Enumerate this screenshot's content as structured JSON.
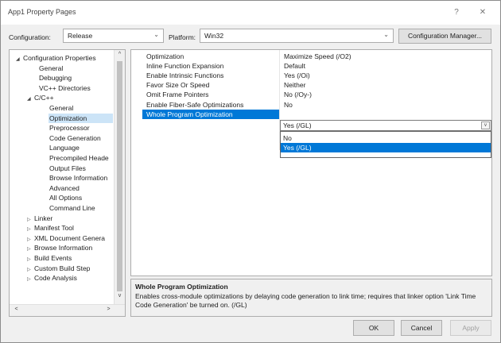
{
  "window": {
    "title": "App1 Property Pages",
    "help": "?",
    "close": "✕"
  },
  "config": {
    "configuration_label": "Configuration:",
    "configuration_value": "Release",
    "platform_label": "Platform:",
    "platform_value": "Win32",
    "manager_button": "Configuration Manager..."
  },
  "tree": {
    "items": [
      {
        "label": "Configuration Properties",
        "twisty": "◢"
      },
      {
        "label": "General"
      },
      {
        "label": "Debugging"
      },
      {
        "label": "VC++ Directories"
      },
      {
        "label": "C/C++",
        "twisty": "◢"
      },
      {
        "label": "General"
      },
      {
        "label": "Optimization"
      },
      {
        "label": "Preprocessor"
      },
      {
        "label": "Code Generation"
      },
      {
        "label": "Language"
      },
      {
        "label": "Precompiled Heade"
      },
      {
        "label": "Output Files"
      },
      {
        "label": "Browse Information"
      },
      {
        "label": "Advanced"
      },
      {
        "label": "All Options"
      },
      {
        "label": "Command Line"
      },
      {
        "label": "Linker",
        "twisty": "▷"
      },
      {
        "label": "Manifest Tool",
        "twisty": "▷"
      },
      {
        "label": "XML Document Genera",
        "twisty": "▷"
      },
      {
        "label": "Browse Information",
        "twisty": "▷"
      },
      {
        "label": "Build Events",
        "twisty": "▷"
      },
      {
        "label": "Custom Build Step",
        "twisty": "▷"
      },
      {
        "label": "Code Analysis",
        "twisty": "▷"
      }
    ],
    "scroll_up": "^",
    "scroll_down": "v",
    "scroll_left": "<",
    "scroll_right": ">"
  },
  "properties": [
    {
      "name": "Optimization",
      "value": "Maximize Speed (/O2)"
    },
    {
      "name": "Inline Function Expansion",
      "value": "Default"
    },
    {
      "name": "Enable Intrinsic Functions",
      "value": "Yes (/Oi)"
    },
    {
      "name": "Favor Size Or Speed",
      "value": "Neither"
    },
    {
      "name": "Omit Frame Pointers",
      "value": "No (/Oy-)"
    },
    {
      "name": "Enable Fiber-Safe Optimizations",
      "value": "No"
    },
    {
      "name": "Whole Program Optimization",
      "value": "Yes (/GL)"
    }
  ],
  "dropdown": {
    "value": "Yes (/GL)",
    "arrow": "v",
    "options": [
      "No",
      "Yes (/GL)"
    ]
  },
  "description": {
    "title": "Whole Program Optimization",
    "text": "Enables cross-module optimizations by delaying code generation to link time; requires that linker option 'Link Time Code Generation' be turned on.    (/GL)"
  },
  "footer": {
    "ok": "OK",
    "cancel": "Cancel",
    "apply": "Apply"
  },
  "colors": {
    "selection": "#0078d7",
    "tree_selection": "#cce4f7"
  }
}
